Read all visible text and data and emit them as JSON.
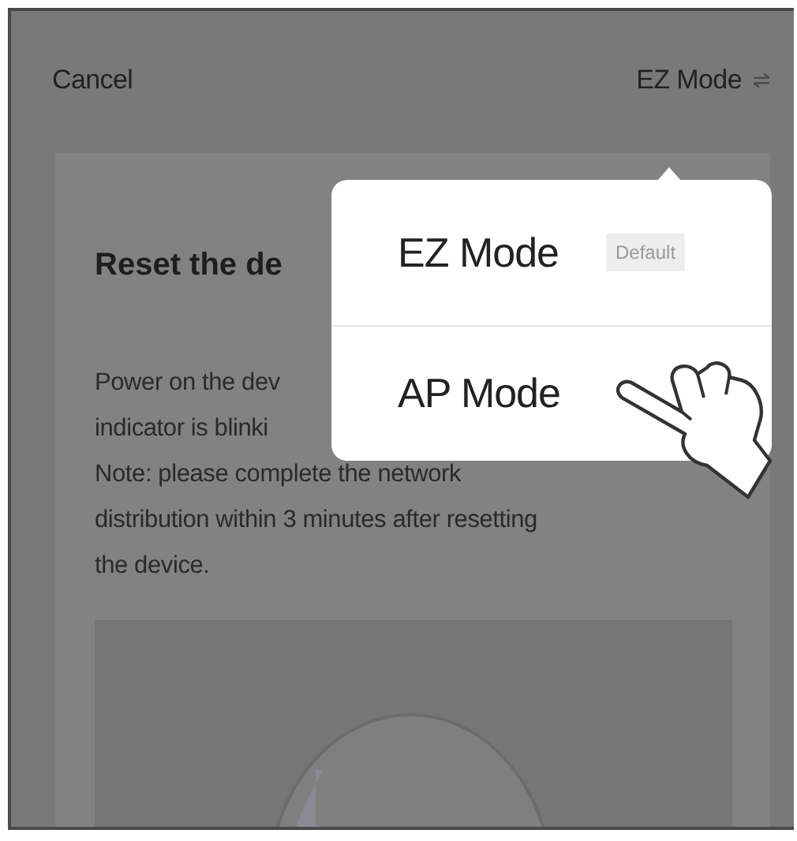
{
  "header": {
    "cancel": "Cancel",
    "mode": "EZ Mode"
  },
  "card": {
    "title": "Reset the de",
    "lines": [
      "Power on the dev",
      "indicator is blinki",
      "Note: please complete the network",
      "distribution within 3 minutes after resetting",
      "the device."
    ]
  },
  "menu": {
    "items": [
      {
        "label": "EZ Mode",
        "badge": "Default",
        "pointer": false
      },
      {
        "label": "AP Mode",
        "pointer": true
      }
    ]
  }
}
